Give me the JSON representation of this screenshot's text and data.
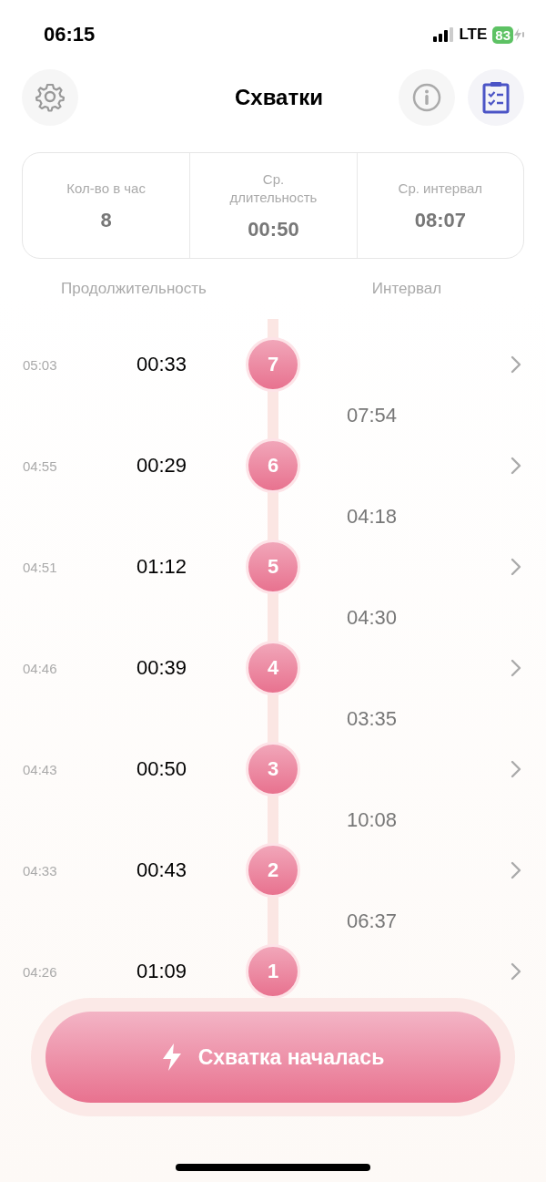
{
  "status_bar": {
    "time": "06:15",
    "network": "LTE",
    "battery": "83"
  },
  "header": {
    "title": "Схватки"
  },
  "stats": [
    {
      "label": "Кол-во в час",
      "value": "8"
    },
    {
      "label": "Ср. длительность",
      "value": "00:50"
    },
    {
      "label": "Ср. интервал",
      "value": "08:07"
    }
  ],
  "columns": [
    "Продолжительность",
    "Интервал"
  ],
  "contractions": [
    {
      "time": "05:03",
      "duration": "00:33",
      "number": "7",
      "interval": "07:54"
    },
    {
      "time": "04:55",
      "duration": "00:29",
      "number": "6",
      "interval": "04:18"
    },
    {
      "time": "04:51",
      "duration": "01:12",
      "number": "5",
      "interval": "04:30"
    },
    {
      "time": "04:46",
      "duration": "00:39",
      "number": "4",
      "interval": "03:35"
    },
    {
      "time": "04:43",
      "duration": "00:50",
      "number": "3",
      "interval": "10:08"
    },
    {
      "time": "04:33",
      "duration": "00:43",
      "number": "2",
      "interval": "06:37"
    },
    {
      "time": "04:26",
      "duration": "01:09",
      "number": "1"
    }
  ],
  "start_button": {
    "label": "Схватка началась"
  }
}
